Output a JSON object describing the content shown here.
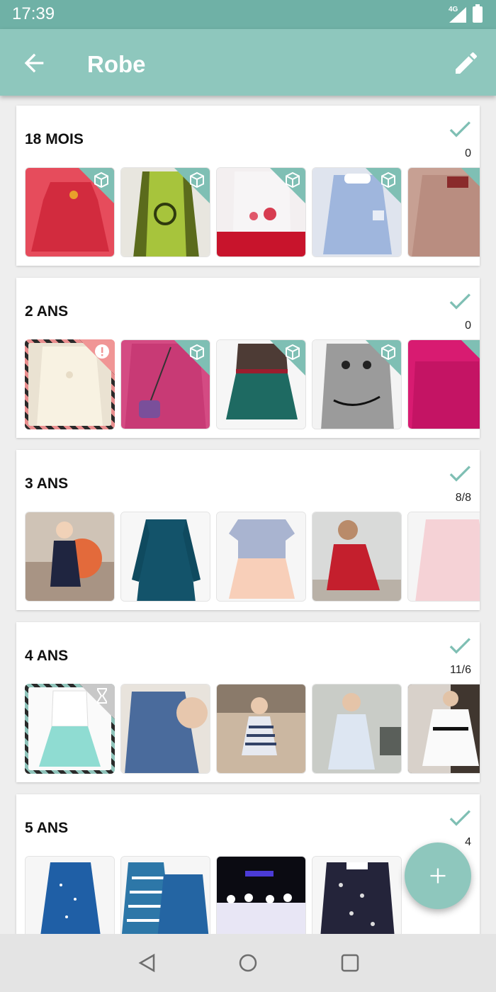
{
  "status_bar": {
    "time": "17:39",
    "network": "4G"
  },
  "toolbar": {
    "title": "Robe",
    "back_icon": "arrow-back-icon",
    "edit_icon": "pencil-icon"
  },
  "accent_color": "#8ec7bd",
  "sections": [
    {
      "label": "18 MOIS",
      "count": "0"
    },
    {
      "label": "2 ANS",
      "count": "0"
    },
    {
      "label": "3 ANS",
      "count": "8/8"
    },
    {
      "label": "4 ANS",
      "count": "11/6"
    },
    {
      "label": "5 ANS",
      "count": "4"
    }
  ],
  "fab": {
    "icon": "plus-icon"
  },
  "nav_bar": {
    "back_icon": "nav-back-icon",
    "home_icon": "nav-home-icon",
    "recents_icon": "nav-recents-icon"
  }
}
